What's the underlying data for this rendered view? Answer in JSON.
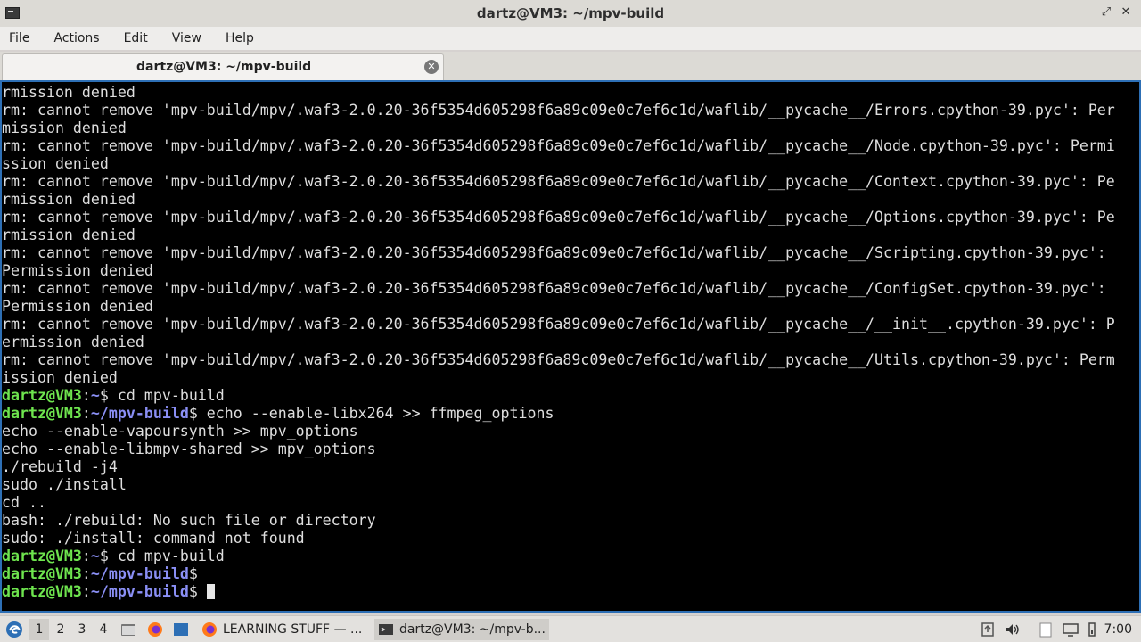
{
  "window": {
    "title": "dartz@VM3: ~/mpv-build",
    "controls": {
      "minimize": "‒",
      "maximize": "⤢",
      "close": "✕"
    }
  },
  "menu": [
    "File",
    "Actions",
    "Edit",
    "View",
    "Help"
  ],
  "tab": {
    "label": "dartz@VM3: ~/mpv-build"
  },
  "terminal": {
    "lines": [
      [
        {
          "t": "rmission denied"
        }
      ],
      [
        {
          "t": "rm: cannot remove 'mpv-build/mpv/.waf3-2.0.20-36f5354d605298f6a89c09e0c7ef6c1d/waflib/__pycache__/Errors.cpython-39.pyc': Per"
        }
      ],
      [
        {
          "t": "mission denied"
        }
      ],
      [
        {
          "t": "rm: cannot remove 'mpv-build/mpv/.waf3-2.0.20-36f5354d605298f6a89c09e0c7ef6c1d/waflib/__pycache__/Node.cpython-39.pyc': Permi"
        }
      ],
      [
        {
          "t": "ssion denied"
        }
      ],
      [
        {
          "t": "rm: cannot remove 'mpv-build/mpv/.waf3-2.0.20-36f5354d605298f6a89c09e0c7ef6c1d/waflib/__pycache__/Context.cpython-39.pyc': Pe"
        }
      ],
      [
        {
          "t": "rmission denied"
        }
      ],
      [
        {
          "t": "rm: cannot remove 'mpv-build/mpv/.waf3-2.0.20-36f5354d605298f6a89c09e0c7ef6c1d/waflib/__pycache__/Options.cpython-39.pyc': Pe"
        }
      ],
      [
        {
          "t": "rmission denied"
        }
      ],
      [
        {
          "t": "rm: cannot remove 'mpv-build/mpv/.waf3-2.0.20-36f5354d605298f6a89c09e0c7ef6c1d/waflib/__pycache__/Scripting.cpython-39.pyc':"
        }
      ],
      [
        {
          "t": "Permission denied"
        }
      ],
      [
        {
          "t": "rm: cannot remove 'mpv-build/mpv/.waf3-2.0.20-36f5354d605298f6a89c09e0c7ef6c1d/waflib/__pycache__/ConfigSet.cpython-39.pyc':"
        }
      ],
      [
        {
          "t": "Permission denied"
        }
      ],
      [
        {
          "t": "rm: cannot remove 'mpv-build/mpv/.waf3-2.0.20-36f5354d605298f6a89c09e0c7ef6c1d/waflib/__pycache__/__init__.cpython-39.pyc': P"
        }
      ],
      [
        {
          "t": "ermission denied"
        }
      ],
      [
        {
          "t": "rm: cannot remove 'mpv-build/mpv/.waf3-2.0.20-36f5354d605298f6a89c09e0c7ef6c1d/waflib/__pycache__/Utils.cpython-39.pyc': Perm"
        }
      ],
      [
        {
          "t": "ission denied"
        }
      ],
      [
        {
          "t": "dartz@VM3",
          "c": "u"
        },
        {
          "t": ":"
        },
        {
          "t": "~",
          "c": "p"
        },
        {
          "t": "$ cd mpv-build"
        }
      ],
      [
        {
          "t": "dartz@VM3",
          "c": "u"
        },
        {
          "t": ":"
        },
        {
          "t": "~/mpv-build",
          "c": "p"
        },
        {
          "t": "$ echo --enable-libx264 >> ffmpeg_options"
        }
      ],
      [
        {
          "t": "echo --enable-vapoursynth >> mpv_options"
        }
      ],
      [
        {
          "t": "echo --enable-libmpv-shared >> mpv_options"
        }
      ],
      [
        {
          "t": "./rebuild -j4"
        }
      ],
      [
        {
          "t": "sudo ./install"
        }
      ],
      [
        {
          "t": "cd .."
        }
      ],
      [
        {
          "t": "bash: ./rebuild: No such file or directory"
        }
      ],
      [
        {
          "t": "sudo: ./install: command not found"
        }
      ],
      [
        {
          "t": "dartz@VM3",
          "c": "u"
        },
        {
          "t": ":"
        },
        {
          "t": "~",
          "c": "p"
        },
        {
          "t": "$ cd mpv-build"
        }
      ],
      [
        {
          "t": "dartz@VM3",
          "c": "u"
        },
        {
          "t": ":"
        },
        {
          "t": "~/mpv-build",
          "c": "p"
        },
        {
          "t": "$"
        }
      ],
      [
        {
          "t": "dartz@VM3",
          "c": "u"
        },
        {
          "t": ":"
        },
        {
          "t": "~/mpv-build",
          "c": "p"
        },
        {
          "t": "$ "
        },
        {
          "cursor": true
        }
      ]
    ]
  },
  "taskbar": {
    "workspaces": [
      "1",
      "2",
      "3",
      "4"
    ],
    "active_workspace": "1",
    "apps": [
      {
        "label": "LEARNING STUFF — ...",
        "icon": "firefox-icon"
      },
      {
        "label": "dartz@VM3: ~/mpv-b...",
        "icon": "terminal-icon"
      }
    ],
    "clock": "7:00"
  }
}
